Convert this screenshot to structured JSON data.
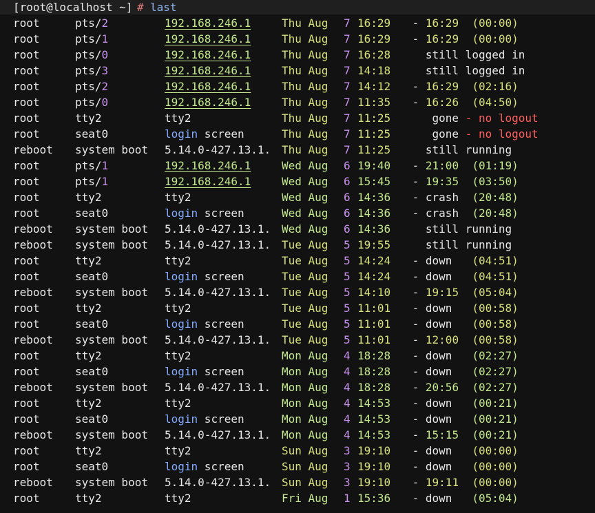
{
  "prompt": {
    "text": "[root@localhost ~]",
    "hash": "#",
    "command": "last"
  },
  "rows": [
    {
      "user": "root",
      "tty": "pts/",
      "ttynum": "2",
      "host": "192.168.246.1",
      "hostType": "ip",
      "day": "Thu Aug",
      "date": "7",
      "time": "16:29",
      "rest": [
        [
          "dash",
          " - "
        ],
        [
          "end",
          "16:29"
        ],
        [
          "plain",
          "  "
        ],
        [
          "dur",
          "(00:00)"
        ]
      ]
    },
    {
      "user": "root",
      "tty": "pts/",
      "ttynum": "1",
      "host": "192.168.246.1",
      "hostType": "ip",
      "day": "Thu Aug",
      "date": "7",
      "time": "16:29",
      "rest": [
        [
          "dash",
          " - "
        ],
        [
          "end",
          "16:29"
        ],
        [
          "plain",
          "  "
        ],
        [
          "dur",
          "(00:00)"
        ]
      ]
    },
    {
      "user": "root",
      "tty": "pts/",
      "ttynum": "0",
      "host": "192.168.246.1",
      "hostType": "ip",
      "day": "Thu Aug",
      "date": "7",
      "time": "16:28",
      "rest": [
        [
          "plain",
          "   still logged in"
        ]
      ]
    },
    {
      "user": "root",
      "tty": "pts/",
      "ttynum": "3",
      "host": "192.168.246.1",
      "hostType": "ip",
      "day": "Thu Aug",
      "date": "7",
      "time": "14:18",
      "rest": [
        [
          "plain",
          "   still logged in"
        ]
      ]
    },
    {
      "user": "root",
      "tty": "pts/",
      "ttynum": "2",
      "host": "192.168.246.1",
      "hostType": "ip",
      "day": "Thu Aug",
      "date": "7",
      "time": "14:12",
      "rest": [
        [
          "dash",
          " - "
        ],
        [
          "end",
          "16:29"
        ],
        [
          "plain",
          "  "
        ],
        [
          "dur",
          "(02:16)"
        ]
      ]
    },
    {
      "user": "root",
      "tty": "pts/",
      "ttynum": "0",
      "host": "192.168.246.1",
      "hostType": "ip",
      "day": "Thu Aug",
      "date": "7",
      "time": "11:35",
      "rest": [
        [
          "dash",
          " - "
        ],
        [
          "end",
          "16:26"
        ],
        [
          "plain",
          "  "
        ],
        [
          "dur",
          "(04:50)"
        ]
      ]
    },
    {
      "user": "root",
      "tty": "tty2",
      "ttynum": "",
      "host": "tty2",
      "hostType": "plain",
      "day": "Thu Aug",
      "date": "7",
      "time": "11:25",
      "rest": [
        [
          "plain",
          "    gone"
        ],
        [
          "red",
          " - no logout"
        ]
      ]
    },
    {
      "user": "root",
      "tty": "seat0",
      "ttynum": "",
      "host": "login screen",
      "hostType": "login",
      "day": "Thu Aug",
      "date": "7",
      "time": "11:25",
      "rest": [
        [
          "plain",
          "    gone"
        ],
        [
          "red",
          " - no logout"
        ]
      ]
    },
    {
      "user": "reboot",
      "tty": "system boot",
      "ttynum": "",
      "host": "5.14.0-427.13.1.",
      "hostType": "plain",
      "day": "Thu Aug",
      "date": "7",
      "time": "11:25",
      "rest": [
        [
          "plain",
          "   still running"
        ]
      ]
    },
    {
      "user": "root",
      "tty": "pts/",
      "ttynum": "1",
      "host": "192.168.246.1",
      "hostType": "ip",
      "day": "Wed Aug",
      "date": "6",
      "time": "19:40",
      "wk": true,
      "rest": [
        [
          "dash",
          " - "
        ],
        [
          "end",
          "21:00"
        ],
        [
          "plain",
          "  "
        ],
        [
          "dur",
          "(01:19)"
        ]
      ]
    },
    {
      "user": "root",
      "tty": "pts/",
      "ttynum": "1",
      "host": "192.168.246.1",
      "hostType": "ip",
      "day": "Wed Aug",
      "date": "6",
      "time": "15:45",
      "wk": true,
      "rest": [
        [
          "dash",
          " - "
        ],
        [
          "end",
          "19:35"
        ],
        [
          "plain",
          "  "
        ],
        [
          "dur",
          "(03:50)"
        ]
      ]
    },
    {
      "user": "root",
      "tty": "tty2",
      "ttynum": "",
      "host": "tty2",
      "hostType": "plain",
      "day": "Wed Aug",
      "date": "6",
      "time": "14:36",
      "wk": true,
      "rest": [
        [
          "dash",
          " - "
        ],
        [
          "plain",
          "crash"
        ],
        [
          "plain",
          "  "
        ],
        [
          "dur",
          "(20:48)"
        ]
      ]
    },
    {
      "user": "root",
      "tty": "seat0",
      "ttynum": "",
      "host": "login screen",
      "hostType": "login",
      "day": "Wed Aug",
      "date": "6",
      "time": "14:36",
      "wk": true,
      "rest": [
        [
          "dash",
          " - "
        ],
        [
          "plain",
          "crash"
        ],
        [
          "plain",
          "  "
        ],
        [
          "dur",
          "(20:48)"
        ]
      ]
    },
    {
      "user": "reboot",
      "tty": "system boot",
      "ttynum": "",
      "host": "5.14.0-427.13.1.",
      "hostType": "plain",
      "day": "Wed Aug",
      "date": "6",
      "time": "14:36",
      "wk": true,
      "rest": [
        [
          "plain",
          "   still running"
        ]
      ]
    },
    {
      "user": "reboot",
      "tty": "system boot",
      "ttynum": "",
      "host": "5.14.0-427.13.1.",
      "hostType": "plain",
      "day": "Tue Aug",
      "date": "5",
      "time": "19:55",
      "rest": [
        [
          "plain",
          "   still running"
        ]
      ]
    },
    {
      "user": "root",
      "tty": "tty2",
      "ttynum": "",
      "host": "tty2",
      "hostType": "plain",
      "day": "Tue Aug",
      "date": "5",
      "time": "14:24",
      "rest": [
        [
          "dash",
          " - "
        ],
        [
          "plain",
          "down"
        ],
        [
          "plain",
          "   "
        ],
        [
          "dur",
          "(04:51)"
        ]
      ]
    },
    {
      "user": "root",
      "tty": "seat0",
      "ttynum": "",
      "host": "login screen",
      "hostType": "login",
      "day": "Tue Aug",
      "date": "5",
      "time": "14:24",
      "rest": [
        [
          "dash",
          " - "
        ],
        [
          "plain",
          "down"
        ],
        [
          "plain",
          "   "
        ],
        [
          "dur",
          "(04:51)"
        ]
      ]
    },
    {
      "user": "reboot",
      "tty": "system boot",
      "ttynum": "",
      "host": "5.14.0-427.13.1.",
      "hostType": "plain",
      "day": "Tue Aug",
      "date": "5",
      "time": "14:10",
      "rest": [
        [
          "dash",
          " - "
        ],
        [
          "end",
          "19:15"
        ],
        [
          "plain",
          "  "
        ],
        [
          "dur",
          "(05:04)"
        ]
      ]
    },
    {
      "user": "root",
      "tty": "tty2",
      "ttynum": "",
      "host": "tty2",
      "hostType": "plain",
      "day": "Tue Aug",
      "date": "5",
      "time": "11:01",
      "rest": [
        [
          "dash",
          " - "
        ],
        [
          "plain",
          "down"
        ],
        [
          "plain",
          "   "
        ],
        [
          "dur",
          "(00:58)"
        ]
      ]
    },
    {
      "user": "root",
      "tty": "seat0",
      "ttynum": "",
      "host": "login screen",
      "hostType": "login",
      "day": "Tue Aug",
      "date": "5",
      "time": "11:01",
      "rest": [
        [
          "dash",
          " - "
        ],
        [
          "plain",
          "down"
        ],
        [
          "plain",
          "   "
        ],
        [
          "dur",
          "(00:58)"
        ]
      ]
    },
    {
      "user": "reboot",
      "tty": "system boot",
      "ttynum": "",
      "host": "5.14.0-427.13.1.",
      "hostType": "plain",
      "day": "Tue Aug",
      "date": "5",
      "time": "11:01",
      "rest": [
        [
          "dash",
          " - "
        ],
        [
          "end",
          "12:00"
        ],
        [
          "plain",
          "  "
        ],
        [
          "dur",
          "(00:58)"
        ]
      ]
    },
    {
      "user": "root",
      "tty": "tty2",
      "ttynum": "",
      "host": "tty2",
      "hostType": "plain",
      "day": "Mon Aug",
      "date": "4",
      "time": "18:28",
      "wk": true,
      "rest": [
        [
          "dash",
          " - "
        ],
        [
          "plain",
          "down"
        ],
        [
          "plain",
          "   "
        ],
        [
          "dur",
          "(02:27)"
        ]
      ]
    },
    {
      "user": "root",
      "tty": "seat0",
      "ttynum": "",
      "host": "login screen",
      "hostType": "login",
      "day": "Mon Aug",
      "date": "4",
      "time": "18:28",
      "wk": true,
      "rest": [
        [
          "dash",
          " - "
        ],
        [
          "plain",
          "down"
        ],
        [
          "plain",
          "   "
        ],
        [
          "dur",
          "(02:27)"
        ]
      ]
    },
    {
      "user": "reboot",
      "tty": "system boot",
      "ttynum": "",
      "host": "5.14.0-427.13.1.",
      "hostType": "plain",
      "day": "Mon Aug",
      "date": "4",
      "time": "18:28",
      "wk": true,
      "rest": [
        [
          "dash",
          " - "
        ],
        [
          "end",
          "20:56"
        ],
        [
          "plain",
          "  "
        ],
        [
          "dur",
          "(02:27)"
        ]
      ]
    },
    {
      "user": "root",
      "tty": "tty2",
      "ttynum": "",
      "host": "tty2",
      "hostType": "plain",
      "day": "Mon Aug",
      "date": "4",
      "time": "14:53",
      "wk": true,
      "rest": [
        [
          "dash",
          " - "
        ],
        [
          "plain",
          "down"
        ],
        [
          "plain",
          "   "
        ],
        [
          "dur",
          "(00:21)"
        ]
      ]
    },
    {
      "user": "root",
      "tty": "seat0",
      "ttynum": "",
      "host": "login screen",
      "hostType": "login",
      "day": "Mon Aug",
      "date": "4",
      "time": "14:53",
      "wk": true,
      "rest": [
        [
          "dash",
          " - "
        ],
        [
          "plain",
          "down"
        ],
        [
          "plain",
          "   "
        ],
        [
          "dur",
          "(00:21)"
        ]
      ]
    },
    {
      "user": "reboot",
      "tty": "system boot",
      "ttynum": "",
      "host": "5.14.0-427.13.1.",
      "hostType": "plain",
      "day": "Mon Aug",
      "date": "4",
      "time": "14:53",
      "wk": true,
      "rest": [
        [
          "dash",
          " - "
        ],
        [
          "end",
          "15:15"
        ],
        [
          "plain",
          "  "
        ],
        [
          "dur",
          "(00:21)"
        ]
      ]
    },
    {
      "user": "root",
      "tty": "tty2",
      "ttynum": "",
      "host": "tty2",
      "hostType": "plain",
      "day": "Sun Aug",
      "date": "3",
      "time": "19:10",
      "rest": [
        [
          "dash",
          " - "
        ],
        [
          "plain",
          "down"
        ],
        [
          "plain",
          "   "
        ],
        [
          "dur",
          "(00:00)"
        ]
      ]
    },
    {
      "user": "root",
      "tty": "seat0",
      "ttynum": "",
      "host": "login screen",
      "hostType": "login",
      "day": "Sun Aug",
      "date": "3",
      "time": "19:10",
      "rest": [
        [
          "dash",
          " - "
        ],
        [
          "plain",
          "down"
        ],
        [
          "plain",
          "   "
        ],
        [
          "dur",
          "(00:00)"
        ]
      ]
    },
    {
      "user": "reboot",
      "tty": "system boot",
      "ttynum": "",
      "host": "5.14.0-427.13.1.",
      "hostType": "plain",
      "day": "Sun Aug",
      "date": "3",
      "time": "19:10",
      "rest": [
        [
          "dash",
          " - "
        ],
        [
          "end",
          "19:11"
        ],
        [
          "plain",
          "  "
        ],
        [
          "dur",
          "(00:00)"
        ]
      ]
    },
    {
      "user": "root",
      "tty": "tty2",
      "ttynum": "",
      "host": "tty2",
      "hostType": "plain",
      "day": "Fri Aug",
      "date": "1",
      "time": "15:36",
      "wk": true,
      "rest": [
        [
          "dash",
          " - "
        ],
        [
          "plain",
          "down"
        ],
        [
          "plain",
          "   "
        ],
        [
          "dur",
          "(05:04)"
        ]
      ]
    }
  ],
  "colors": {
    "background": "#121212",
    "prompt_bar": "#1f1f1f",
    "ip": "#c3e88d",
    "date_num": "#c792ea",
    "time_yellow": "#d7e07a",
    "time_green": "#c3e88d",
    "login_keyword": "#82aaff",
    "no_logout": "#ff5f5f"
  }
}
